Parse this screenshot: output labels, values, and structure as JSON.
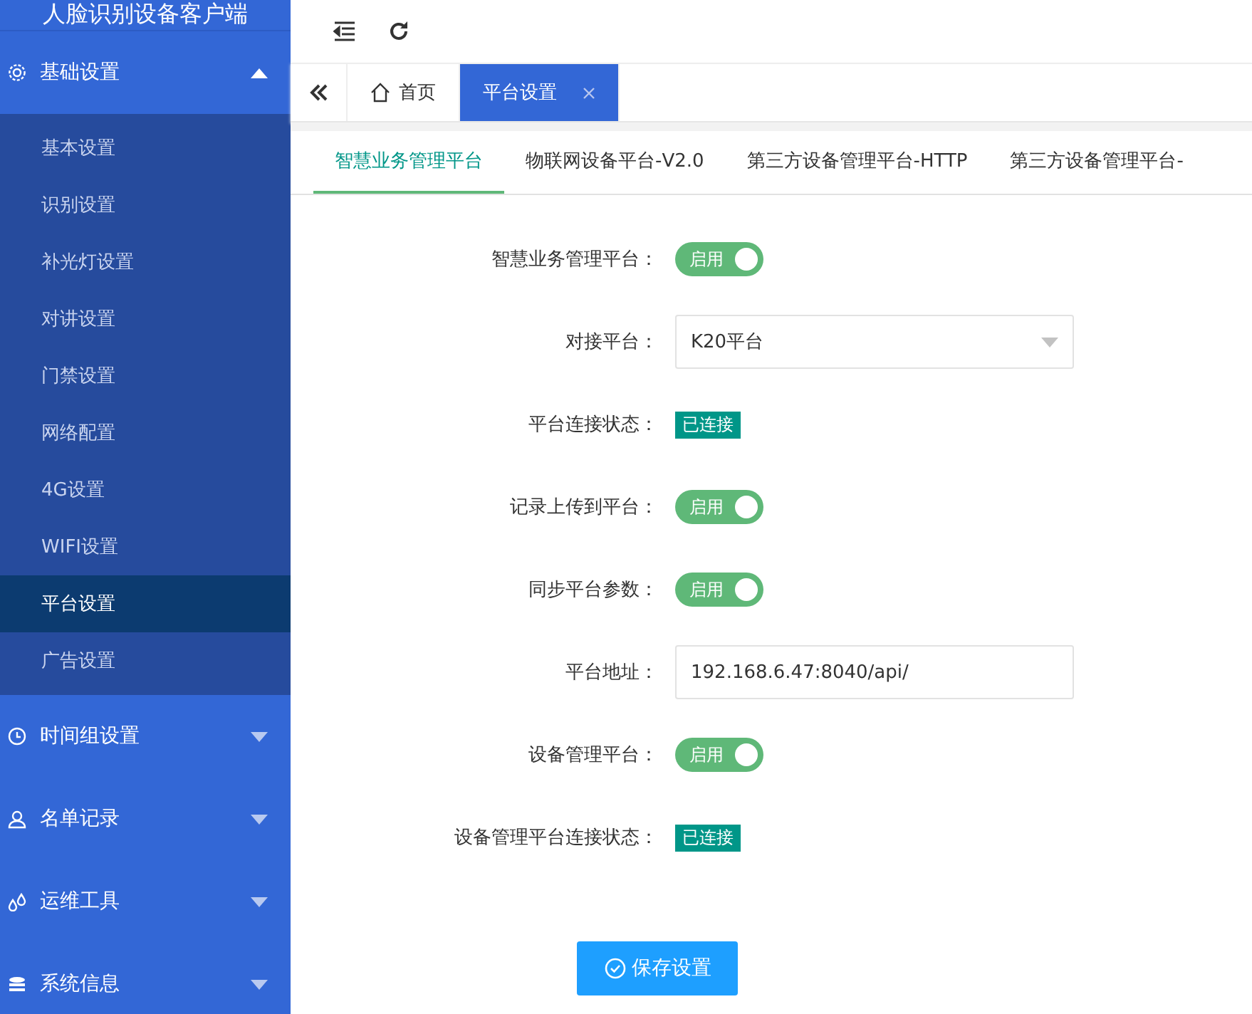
{
  "app_title": "人脸识别设备客户端",
  "sidebar": {
    "groups": [
      {
        "label": "基础设置",
        "kind": "gear",
        "expanded": true,
        "items": [
          {
            "label": "基本设置",
            "selected": false
          },
          {
            "label": "识别设置",
            "selected": false
          },
          {
            "label": "补光灯设置",
            "selected": false
          },
          {
            "label": "对讲设置",
            "selected": false
          },
          {
            "label": "门禁设置",
            "selected": false
          },
          {
            "label": "网络配置",
            "selected": false
          },
          {
            "label": "4G设置",
            "selected": false
          },
          {
            "label": "WIFI设置",
            "selected": false
          },
          {
            "label": "平台设置",
            "selected": true
          },
          {
            "label": "广告设置",
            "selected": false
          }
        ]
      },
      {
        "label": "时间组设置",
        "kind": "clock",
        "expanded": false
      },
      {
        "label": "名单记录",
        "kind": "person",
        "expanded": false
      },
      {
        "label": "运维工具",
        "kind": "drops",
        "expanded": false
      },
      {
        "label": "系统信息",
        "kind": "stack",
        "expanded": false
      }
    ]
  },
  "page_tabs": [
    {
      "label": "首页",
      "kind": "home",
      "selected": false
    },
    {
      "label": "平台设置",
      "kind": "closable",
      "selected": true
    }
  ],
  "sub_tabs": [
    {
      "label": "智慧业务管理平台",
      "selected": true
    },
    {
      "label": "物联网设备平台-V2.0",
      "selected": false
    },
    {
      "label": "第三方设备管理平台-HTTP",
      "selected": false
    },
    {
      "label": "第三方设备管理平台-",
      "selected": false
    }
  ],
  "form": [
    {
      "label": "智慧业务管理平台：",
      "kind": "switch",
      "on": true,
      "text": "启用"
    },
    {
      "label": "对接平台：",
      "kind": "select",
      "value": "K20平台"
    },
    {
      "label": "平台连接状态：",
      "kind": "status",
      "text": "已连接"
    },
    {
      "label": "记录上传到平台：",
      "kind": "switch",
      "on": true,
      "text": "启用"
    },
    {
      "label": "同步平台参数：",
      "kind": "switch",
      "on": true,
      "text": "启用"
    },
    {
      "label": "平台地址：",
      "kind": "input",
      "value": "192.168.6.47:8040/api/"
    },
    {
      "label": "设备管理平台：",
      "kind": "switch",
      "on": true,
      "text": "启用"
    },
    {
      "label": "设备管理平台连接状态：",
      "kind": "status",
      "text": "已连接"
    }
  ],
  "save_button": "保存设置"
}
